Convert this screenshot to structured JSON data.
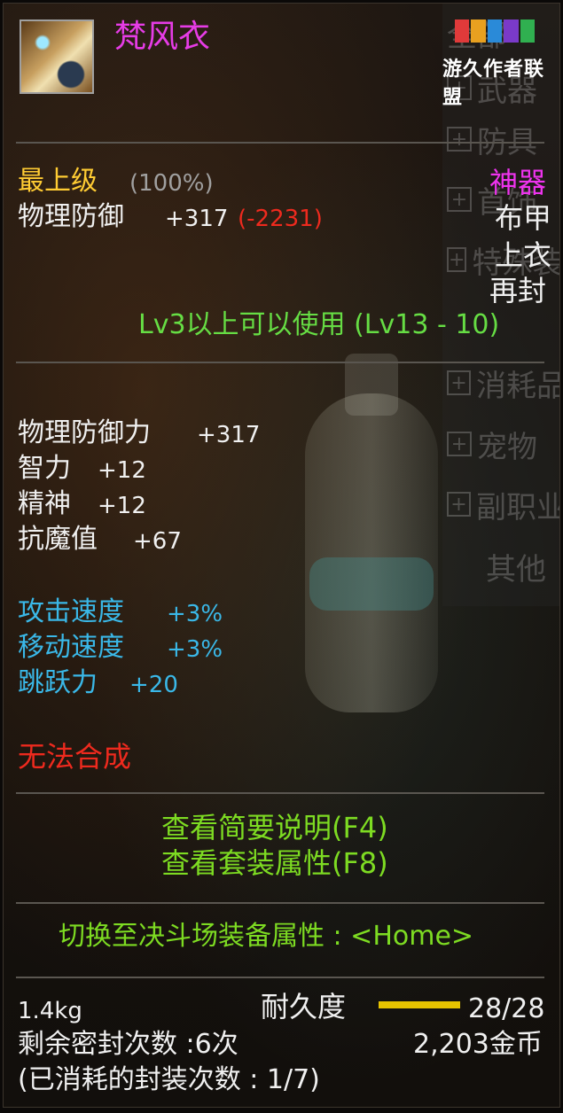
{
  "item": {
    "name": "梵风衣",
    "icon": "robe-item-icon"
  },
  "watermark": {
    "text": "游久作者联盟",
    "colors": [
      "#e03a3a",
      "#e8a020",
      "#2a8ad8",
      "#7a3ac8",
      "#30b050"
    ]
  },
  "side_panel": {
    "items": [
      "全部",
      "武器",
      "防具",
      "首饰",
      "特殊装备",
      "消耗品",
      "宠物",
      "副职业",
      "其他"
    ]
  },
  "grade": {
    "label": "最上级",
    "percent": "(100%)"
  },
  "rarity": "神器",
  "base_defense": {
    "label": "物理防御",
    "value": "+317",
    "compare": "(-2231)"
  },
  "armor_type": "布甲",
  "slot": "上衣",
  "reseal": "再封",
  "level_req": "Lv3以上可以使用 (Lv13 - 10)",
  "stats": [
    {
      "label": "物理防御力",
      "value": "+317"
    },
    {
      "label": "智力",
      "value": "+12"
    },
    {
      "label": "精神",
      "value": "+12"
    },
    {
      "label": "抗魔值",
      "value": "+67"
    }
  ],
  "bonus_stats": [
    {
      "label": "攻击速度",
      "value": "+3%"
    },
    {
      "label": "移动速度",
      "value": "+3%"
    },
    {
      "label": "跳跃力",
      "value": "+20"
    }
  ],
  "cannot_synthesize": "无法合成",
  "links": {
    "brief": "查看简要说明(F4)",
    "set": "查看套装属性(F8)",
    "arena": "切换至决斗场装备属性 : <Home>"
  },
  "footer": {
    "weight": "1.4kg",
    "durability_label": "耐久度",
    "durability_value": "28/28",
    "durability_fraction": 1.0,
    "seal_remaining": "剩余密封次数 :6次",
    "price": "2,203金币",
    "seal_used": "(已消耗的封装次数 : 1/7)"
  },
  "colors": {
    "name": "#e63ce6",
    "grade": "#ffcc33",
    "compare_negative": "#ee2a1e",
    "rarity": "#ee33ee",
    "level": "#66dd44",
    "bonus": "#3ab8e8",
    "link": "#7ddb22",
    "durability_bar": "#e8c400"
  }
}
